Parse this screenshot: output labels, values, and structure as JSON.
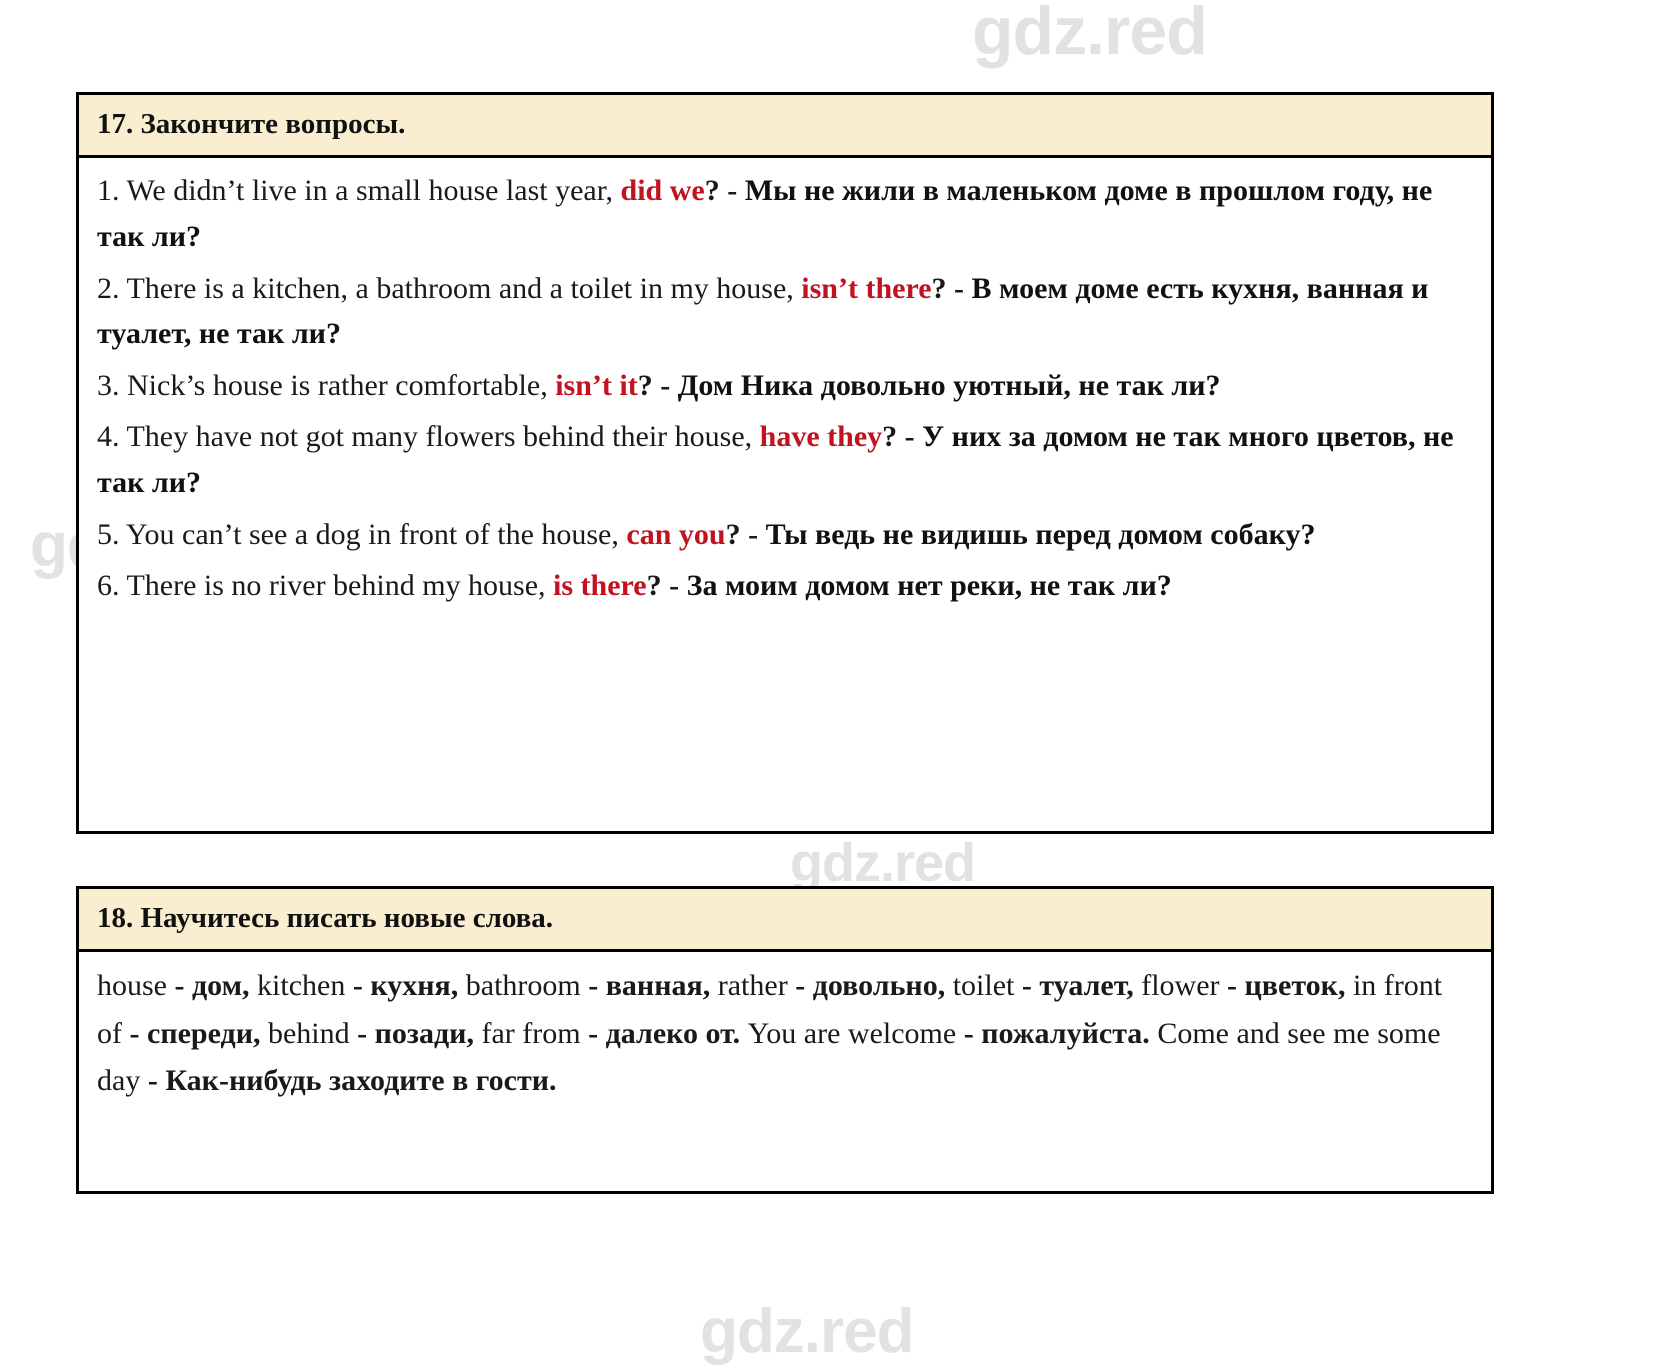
{
  "watermark": {
    "text": "gdz.red",
    "color": "#e2e2e2",
    "occurrences": 6
  },
  "colors": {
    "header_background": "#faeed0",
    "border": "#000000",
    "tag_accent": "#c1121f",
    "body_text": "#1a1a1a",
    "page_background": "#ffffff"
  },
  "exercises": [
    {
      "number": "17",
      "header": "17. Закончите вопросы.",
      "items": [
        {
          "index": "1.",
          "english_before": "We didn’t live in a small house last year,",
          "tag": "did we",
          "punct": "? - ",
          "russian": "Мы не жили в маленьком доме в прошлом году, не так ли?"
        },
        {
          "index": "2.",
          "english_before": "There is a kitchen, a bathroom and a toilet in my house,",
          "tag": "isn’t there",
          "punct": "? - ",
          "russian": "В моем доме есть кухня, ванная и туалет, не так ли?"
        },
        {
          "index": "3.",
          "english_before": "Nick’s house is rather comfortable,",
          "tag": "isn’t it",
          "punct": "? - ",
          "russian": "Дом Ника довольно уютный, не так ли?"
        },
        {
          "index": "4.",
          "english_before": "They have not got many flowers behind their house,",
          "tag": "have they",
          "punct": "? - ",
          "russian": "У них за домом не так много цветов, не так ли?"
        },
        {
          "index": "5.",
          "english_before": "You can’t see a dog in front of the house,",
          "tag": "can you",
          "punct": "? - ",
          "russian": "Ты ведь не видишь перед домом собаку?"
        },
        {
          "index": "6.",
          "english_before": "There is no river behind my house,",
          "tag": "is there",
          "punct": "? - ",
          "russian": "За моим домом нет реки, не так ли?"
        }
      ]
    },
    {
      "number": "18",
      "header": "18. Научитесь писать новые слова.",
      "vocabulary": [
        {
          "en": "house",
          "sep": " - ",
          "ru": "дом,",
          "tail": " "
        },
        {
          "en": "kitchen",
          "sep": " - ",
          "ru": "кухня,",
          "tail": " "
        },
        {
          "en": "bathroom",
          "sep": " - ",
          "ru": "ванная,",
          "tail": " "
        },
        {
          "en": "rather",
          "sep": " - ",
          "ru": "довольно,",
          "tail": " "
        },
        {
          "en": "toilet",
          "sep": " - ",
          "ru": "туалет,",
          "tail": " "
        },
        {
          "en": "flower",
          "sep": " - ",
          "ru": "цветок,",
          "tail": " "
        },
        {
          "en": "in front of",
          "sep": " - ",
          "ru": "спереди,",
          "tail": " "
        },
        {
          "en": "behind",
          "sep": " - ",
          "ru": "позади,",
          "tail": " "
        },
        {
          "en": "far from",
          "sep": " - ",
          "ru": "далеко от.",
          "tail": " "
        },
        {
          "en": "You are welcome",
          "sep": " - ",
          "ru": "пожалуйста.",
          "tail": " "
        },
        {
          "en": "Come and see me some day",
          "sep": " - ",
          "ru": "Как-нибудь заходите в гости.",
          "tail": ""
        }
      ]
    }
  ]
}
